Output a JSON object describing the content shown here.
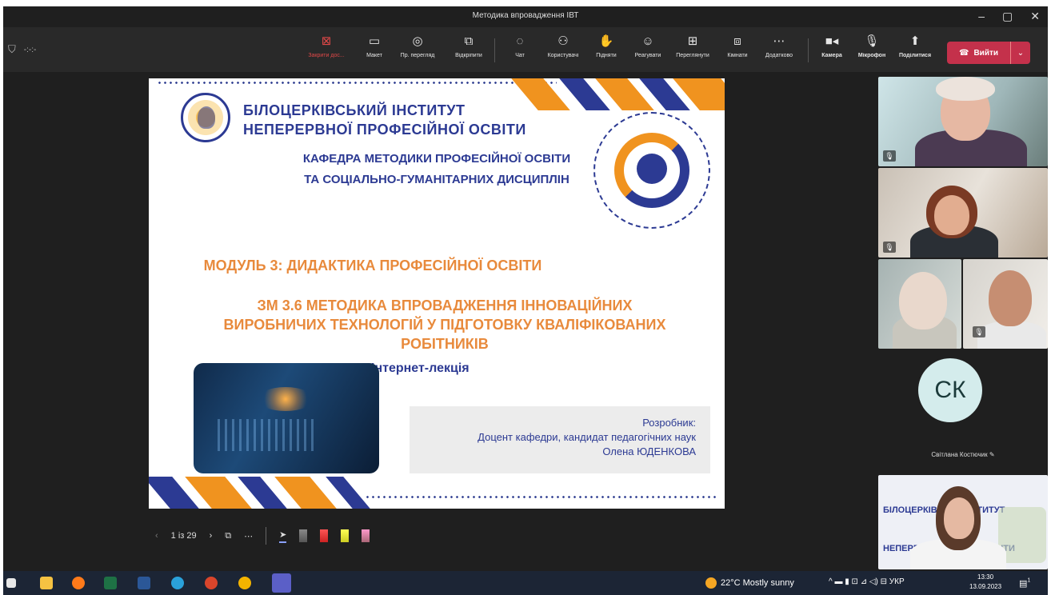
{
  "window": {
    "title": "Методика впровадження ІВТ",
    "controls": [
      "‒",
      "▢",
      "✕"
    ]
  },
  "toolbar": {
    "left_text": "-:-:-",
    "buttons": [
      {
        "name": "stop-sharing",
        "label": "Закрити дос...",
        "icon": "stop-share-icon",
        "glyph": "⊠"
      },
      {
        "name": "layout",
        "label": "Макет",
        "icon": "layout-icon",
        "glyph": "▭"
      },
      {
        "name": "presenter-view",
        "label": "Пр. перегляд",
        "icon": "eye-icon",
        "glyph": "◎"
      },
      {
        "name": "pop-out",
        "label": "Відкріпити",
        "icon": "pop-out-icon",
        "glyph": "⧉"
      },
      {
        "name": "chat",
        "label": "Чат",
        "icon": "chat-icon",
        "glyph": "◌"
      },
      {
        "name": "people",
        "label": "Користувачі",
        "icon": "people-icon",
        "glyph": "⚇"
      },
      {
        "name": "raise-hand",
        "label": "Підняти",
        "icon": "hand-icon",
        "glyph": "✋"
      },
      {
        "name": "react",
        "label": "Реагувати",
        "icon": "smile-icon",
        "glyph": "☺"
      },
      {
        "name": "view",
        "label": "Переглянути",
        "icon": "grid-icon",
        "glyph": "⊞"
      },
      {
        "name": "rooms",
        "label": "Кімнати",
        "icon": "rooms-icon",
        "glyph": "⧈"
      },
      {
        "name": "more",
        "label": "Додатково",
        "icon": "more-icon",
        "glyph": "⋯"
      },
      {
        "name": "camera",
        "label": "Камера",
        "icon": "camera-icon",
        "glyph": "■◂"
      },
      {
        "name": "mic",
        "label": "Мікрофон",
        "icon": "mic-icon",
        "glyph": "🎙"
      },
      {
        "name": "share",
        "label": "Поділитися",
        "icon": "share-icon",
        "glyph": "⬆"
      }
    ],
    "leave": {
      "label": "Вийти",
      "icon": "phone-hangup-icon",
      "glyph": "☎",
      "dropdown": "⌄"
    }
  },
  "slide": {
    "institute_line1": "БІЛОЦЕРКІВСЬКИЙ ІНСТИТУТ",
    "institute_line2": "НЕПЕРЕРВНОЇ ПРОФЕСІЙНОЇ ОСВІТИ",
    "department_line1": "КАФЕДРА МЕТОДИКИ ПРОФЕСІЙНОЇ ОСВІТИ",
    "department_line2": "ТА СОЦІАЛЬНО-ГУМАНІТАРНИХ ДИСЦИПЛІН",
    "module": "МОДУЛЬ 3: ДИДАКТИКА ПРОФЕСІЙНОЇ ОСВІТИ",
    "topic_line1": "ЗМ 3.6 МЕТОДИКА ВПРОВАДЖЕННЯ ІННОВАЦІЙНИХ",
    "topic_line2": "ВИРОБНИЧИХ ТЕХНОЛОГІЙ У ПІДГОТОВКУ КВАЛІФІКОВАНИХ",
    "topic_line3": "РОБІТНИКІВ",
    "lecture_type": "Інтернет-лекція",
    "author_label": "Розробник:",
    "author_position": "Доцент кафедри, кандидат педагогічних наук",
    "author_name": "Олена ЮДЕНКОВА",
    "colors": {
      "blue": "#2c3a93",
      "orange": "#f0931f",
      "title_orange": "#e88a3c"
    }
  },
  "slide_controls": {
    "prev": "‹",
    "counter": "1 із 29",
    "next": "›",
    "grid": "⧉",
    "more": "⋯",
    "pointer": "➤"
  },
  "participants": {
    "avatar_initials": "СК",
    "avatar_name": "Світлана Костючик",
    "mic_glyph": "🎙",
    "presenter_bg_line1": "БІЛОЦЕРКІВ    ИЙ ІНСТИТУТ",
    "presenter_bg_line2": "НЕПЕРЕРВНО    ІЙНОЇ ОСВІТИ"
  },
  "taskbar": {
    "weather": "22°C  Mostly sunny",
    "tray": "^ ▬ ▮ ⊡ ⊿ ◁) ⊟ УКР",
    "time": "13:30",
    "date": "13.09.2023",
    "notifications": "1"
  }
}
